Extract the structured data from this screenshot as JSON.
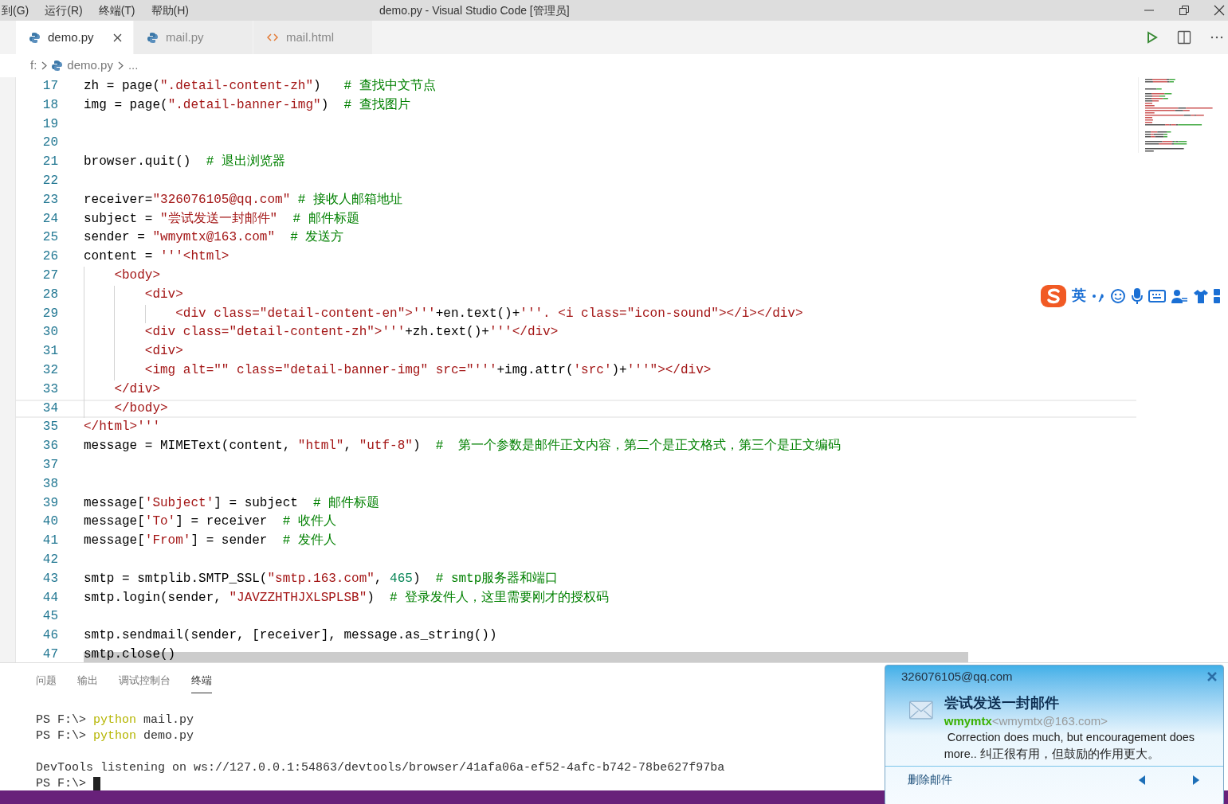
{
  "menu": [
    "到(G)",
    "运行(R)",
    "终端(T)",
    "帮助(H)"
  ],
  "window": {
    "title": "demo.py - Visual Studio Code [管理员]"
  },
  "tabs": [
    {
      "label": "demo.py",
      "kind": "python",
      "selected": true
    },
    {
      "label": "mail.py",
      "kind": "python",
      "selected": false
    },
    {
      "label": "mail.html",
      "kind": "html",
      "selected": false
    }
  ],
  "breadcrumb": [
    {
      "label": "f:",
      "kind": "folder"
    },
    {
      "label": "demo.py",
      "kind": "python"
    },
    {
      "label": "...",
      "kind": "more"
    }
  ],
  "editor": {
    "lines": [
      {
        "number": "17",
        "current": false,
        "tokens": [
          {
            "kind": "plain",
            "text": "zh = page("
          },
          {
            "kind": "string",
            "text": "\".detail-content-zh\""
          },
          {
            "kind": "plain",
            "text": ")   "
          },
          {
            "kind": "comment",
            "text": "# 查找中文节点"
          }
        ]
      },
      {
        "number": "18",
        "current": false,
        "tokens": [
          {
            "kind": "plain",
            "text": "img = page("
          },
          {
            "kind": "string",
            "text": "\".detail-banner-img\""
          },
          {
            "kind": "plain",
            "text": ")  "
          },
          {
            "kind": "comment",
            "text": "# 查找图片"
          }
        ]
      },
      {
        "number": "19",
        "current": false
      },
      {
        "number": "20",
        "current": false
      },
      {
        "number": "21",
        "current": false,
        "tokens": [
          {
            "kind": "plain",
            "text": "browser.quit()  "
          },
          {
            "kind": "comment",
            "text": "# 退出浏览器"
          }
        ]
      },
      {
        "number": "22",
        "current": false
      },
      {
        "number": "23",
        "current": false,
        "tokens": [
          {
            "kind": "plain",
            "text": "receiver="
          },
          {
            "kind": "string",
            "text": "\"326076105@qq.com\""
          },
          {
            "kind": "comment",
            "text": " # 接收人邮箱地址"
          }
        ]
      },
      {
        "number": "24",
        "current": false,
        "tokens": [
          {
            "kind": "plain",
            "text": "subject = "
          },
          {
            "kind": "string",
            "text": "\"尝试发送一封邮件\""
          },
          {
            "kind": "comment",
            "text": "  # 邮件标题"
          }
        ]
      },
      {
        "number": "25",
        "current": false,
        "tokens": [
          {
            "kind": "plain",
            "text": "sender = "
          },
          {
            "kind": "string",
            "text": "\"wmymtx@163.com\""
          },
          {
            "kind": "comment",
            "text": "  # 发送方"
          }
        ]
      },
      {
        "number": "26",
        "current": false,
        "tokens": [
          {
            "kind": "plain",
            "text": "content = "
          },
          {
            "kind": "string",
            "text": "'''<html>"
          }
        ]
      },
      {
        "number": "27",
        "current": false,
        "tokens": [
          {
            "kind": "string",
            "text": "    <body>"
          }
        ]
      },
      {
        "number": "28",
        "current": false,
        "tokens": [
          {
            "kind": "string",
            "text": "        <div>"
          }
        ]
      },
      {
        "number": "29",
        "current": false,
        "tokens": [
          {
            "kind": "string",
            "text": "            <div class=\"detail-content-en\">'''"
          },
          {
            "kind": "plain",
            "text": "+en.text()+"
          },
          {
            "kind": "string",
            "text": "'''. <i class=\"icon-sound\"></i></div>"
          }
        ]
      },
      {
        "number": "30",
        "current": false,
        "tokens": [
          {
            "kind": "string",
            "text": "        <div class=\"detail-content-zh\">'''"
          },
          {
            "kind": "plain",
            "text": "+zh.text()+"
          },
          {
            "kind": "string",
            "text": "'''</div>"
          }
        ]
      },
      {
        "number": "31",
        "current": false,
        "tokens": [
          {
            "kind": "string",
            "text": "        <div>"
          }
        ]
      },
      {
        "number": "32",
        "current": false,
        "tokens": [
          {
            "kind": "string",
            "text": "        <img alt=\"\" class=\"detail-banner-img\" src=\"'''"
          },
          {
            "kind": "plain",
            "text": "+img.attr("
          },
          {
            "kind": "string",
            "text": "'src'"
          },
          {
            "kind": "plain",
            "text": ")+"
          },
          {
            "kind": "string",
            "text": "'''\"></div>"
          }
        ]
      },
      {
        "number": "33",
        "current": false,
        "tokens": [
          {
            "kind": "string",
            "text": "    </div>"
          }
        ]
      },
      {
        "number": "34",
        "current": true,
        "tokens": [
          {
            "kind": "string",
            "text": "    </body>"
          }
        ]
      },
      {
        "number": "35",
        "current": false,
        "tokens": [
          {
            "kind": "string",
            "text": "</html>'''"
          }
        ]
      },
      {
        "number": "36",
        "current": false,
        "tokens": [
          {
            "kind": "plain",
            "text": "message = MIMEText(content, "
          },
          {
            "kind": "string",
            "text": "\"html\""
          },
          {
            "kind": "plain",
            "text": ", "
          },
          {
            "kind": "string",
            "text": "\"utf-8\""
          },
          {
            "kind": "plain",
            "text": ")  "
          },
          {
            "kind": "comment",
            "text": "#  第一个参数是邮件正文内容，第二个是正文格式，第三个是正文编码"
          }
        ]
      },
      {
        "number": "37",
        "current": false
      },
      {
        "number": "38",
        "current": false
      },
      {
        "number": "39",
        "current": false,
        "tokens": [
          {
            "kind": "plain",
            "text": "message["
          },
          {
            "kind": "string",
            "text": "'Subject'"
          },
          {
            "kind": "plain",
            "text": "] = subject  "
          },
          {
            "kind": "comment",
            "text": "# 邮件标题"
          }
        ]
      },
      {
        "number": "40",
        "current": false,
        "tokens": [
          {
            "kind": "plain",
            "text": "message["
          },
          {
            "kind": "string",
            "text": "'To'"
          },
          {
            "kind": "plain",
            "text": "] = receiver  "
          },
          {
            "kind": "comment",
            "text": "# 收件人"
          }
        ]
      },
      {
        "number": "41",
        "current": false,
        "tokens": [
          {
            "kind": "plain",
            "text": "message["
          },
          {
            "kind": "string",
            "text": "'From'"
          },
          {
            "kind": "plain",
            "text": "] = sender  "
          },
          {
            "kind": "comment",
            "text": "# 发件人"
          }
        ]
      },
      {
        "number": "42",
        "current": false
      },
      {
        "number": "43",
        "current": false,
        "tokens": [
          {
            "kind": "plain",
            "text": "smtp = smtplib.SMTP_SSL("
          },
          {
            "kind": "string",
            "text": "\"smtp.163.com\""
          },
          {
            "kind": "plain",
            "text": ", "
          },
          {
            "kind": "number",
            "text": "465"
          },
          {
            "kind": "plain",
            "text": ")  "
          },
          {
            "kind": "comment",
            "text": "# smtp服务器和端口"
          }
        ]
      },
      {
        "number": "44",
        "current": false,
        "tokens": [
          {
            "kind": "plain",
            "text": "smtp.login(sender, "
          },
          {
            "kind": "string",
            "text": "\"JAVZZHTHJXLSPLSB\""
          },
          {
            "kind": "plain",
            "text": ")  "
          },
          {
            "kind": "comment",
            "text": "# 登录发件人，这里需要刚才的授权码"
          }
        ]
      },
      {
        "number": "45",
        "current": false
      },
      {
        "number": "46",
        "current": false,
        "tokens": [
          {
            "kind": "plain",
            "text": "smtp.sendmail(sender, [receiver], message.as_string())"
          }
        ]
      },
      {
        "number": "47",
        "current": false,
        "tokens": [
          {
            "kind": "plain",
            "text": "smtp.close()"
          }
        ]
      }
    ]
  },
  "panel": {
    "tabs": [
      {
        "label": "问题",
        "selected": false
      },
      {
        "label": "输出",
        "selected": false
      },
      {
        "label": "调试控制台",
        "selected": false
      },
      {
        "label": "终端",
        "selected": true
      }
    ],
    "terminal": [
      {
        "lines": [
          [
            {
              "kind": "plain",
              "text": "PS F:\\> "
            },
            {
              "kind": "command",
              "text": "python"
            },
            {
              "kind": "plain",
              "text": " mail.py"
            }
          ],
          [
            {
              "kind": "plain",
              "text": "PS F:\\> "
            },
            {
              "kind": "command",
              "text": "python"
            },
            {
              "kind": "plain",
              "text": " demo.py"
            }
          ]
        ]
      },
      {
        "lines": [
          [
            {
              "kind": "plain",
              "text": "DevTools listening on ws://127.0.0.1:54863/devtools/browser/41afa06a-ef52-4afc-b742-78be627f97ba"
            }
          ],
          [
            {
              "kind": "plain",
              "text": "PS F:\\> "
            }
          ]
        ]
      }
    ]
  },
  "ime": {
    "mode": "英"
  },
  "notification": {
    "recipient": "326076105@qq.com",
    "subject": "尝试发送一封邮件",
    "sender_name": "wmymtx",
    "sender_email": "<wmymtx@163.com>",
    "body": " Correction does much, but encouragement does more.. 纠正很有用，但鼓励的作用更大。",
    "delete_link": "删除邮件"
  }
}
